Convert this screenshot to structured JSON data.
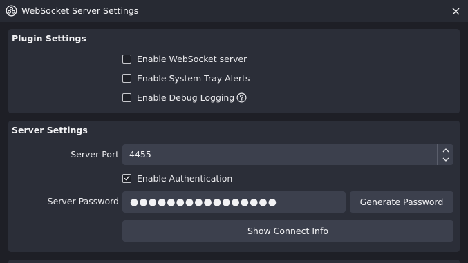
{
  "window": {
    "title": "WebSocket Server Settings",
    "app_icon": "obs-logo-icon",
    "close_icon": "close-icon"
  },
  "plugin_settings": {
    "title": "Plugin Settings",
    "checkboxes": [
      {
        "label": "Enable WebSocket server",
        "checked": false
      },
      {
        "label": "Enable System Tray Alerts",
        "checked": false
      },
      {
        "label": "Enable Debug Logging",
        "checked": false,
        "help_icon": "help-circle-icon"
      }
    ]
  },
  "server_settings": {
    "title": "Server Settings",
    "port_label": "Server Port",
    "port_value": "4455",
    "auth_label": "Enable Authentication",
    "auth_checked": true,
    "password_label": "Server Password",
    "password_dots": "●●●●●●●●●●●●●●●●",
    "generate_button": "Generate Password",
    "connect_button": "Show Connect Info"
  },
  "colors": {
    "background": "#1e1f26",
    "group": "#2b2e38",
    "field": "#3c404d",
    "text": "#e9e9ec"
  }
}
